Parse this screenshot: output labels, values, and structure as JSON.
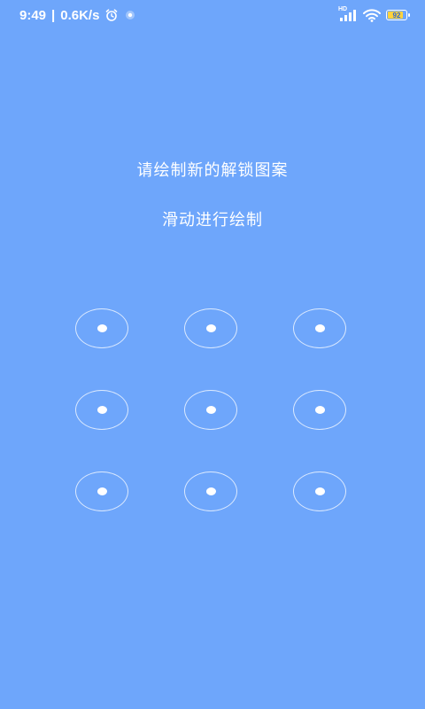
{
  "status_bar": {
    "time": "9:49",
    "separator": "|",
    "network_speed": "0.6K/s",
    "network_label": "HD",
    "battery_level": "92",
    "icons": [
      "alarm-icon",
      "app-notification-icon",
      "signal-icon",
      "wifi-icon",
      "battery-icon"
    ]
  },
  "prompt": {
    "title": "请绘制新的解锁图案",
    "subtitle": "滑动进行绘制"
  },
  "colors": {
    "background": "#6ea6fb",
    "foreground": "#ffffff",
    "battery_fill": "#ffd23c"
  },
  "pattern": {
    "rows": 3,
    "columns": 3,
    "nodes": [
      1,
      2,
      3,
      4,
      5,
      6,
      7,
      8,
      9
    ]
  }
}
